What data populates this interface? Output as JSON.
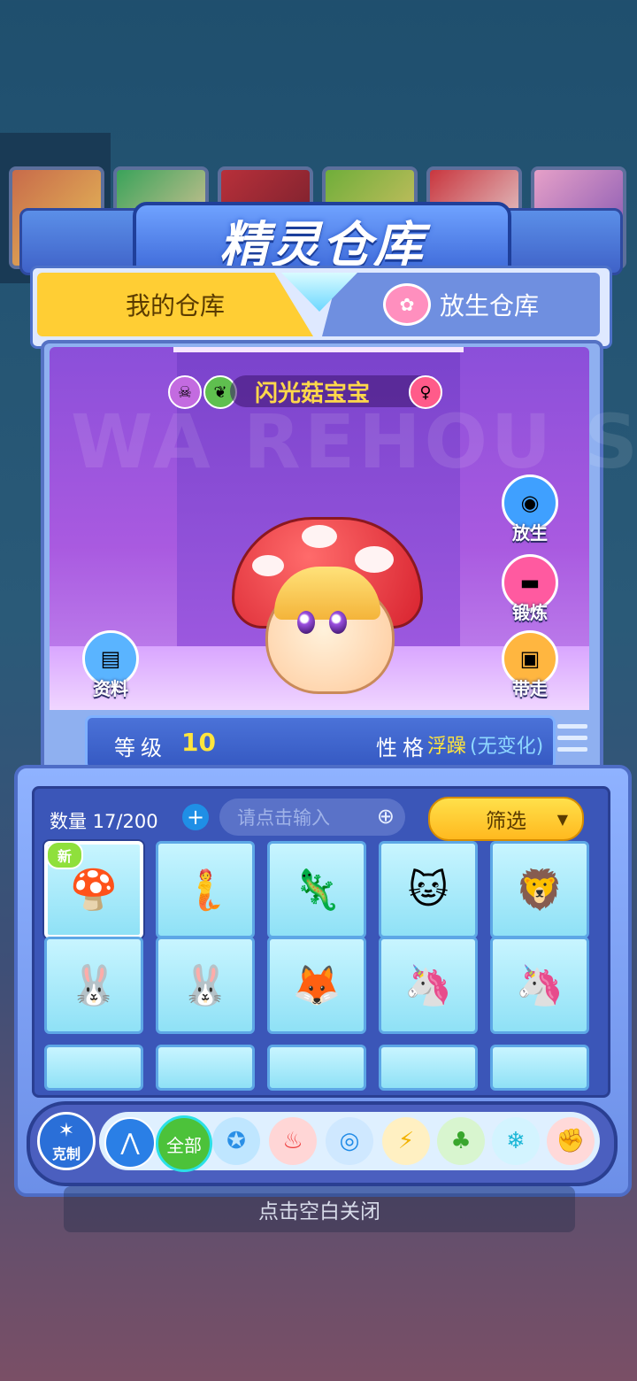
{
  "title": "精灵仓库",
  "tabs": {
    "mine": "我的仓库",
    "release": "放生仓库"
  },
  "display": {
    "watermark": "WA REHOU SE",
    "pet_name": "闪光菇宝宝",
    "badges": [
      "poison-type-icon",
      "grass-type-icon",
      "female-icon"
    ],
    "side_buttons": [
      {
        "label": "放生",
        "icon": "release-icon"
      },
      {
        "label": "锻炼",
        "icon": "dumbbell-icon"
      },
      {
        "label": "带走",
        "icon": "take-away-icon"
      },
      {
        "label": "资料",
        "icon": "profile-icon"
      }
    ]
  },
  "stats": {
    "level_label": "等级",
    "level_value": "10",
    "nature_label": "性格",
    "nature_value": "浮躁",
    "nature_note": "(无变化)"
  },
  "storage": {
    "count": "数量 17/200",
    "search_placeholder": "请点击输入",
    "filter_label": "筛选",
    "new_tag": "新"
  },
  "elements": {
    "restrain_label": "克制",
    "all_label": "全部",
    "items": [
      "collapse-icon",
      "all",
      "normal-icon",
      "fire-icon",
      "water-icon",
      "electric-icon",
      "grass-icon",
      "ice-icon",
      "fighting-icon"
    ]
  },
  "close_tip": "点击空白关闭",
  "colors": {
    "accent_yellow": "#ffce34",
    "panel_blue": "#4e6dc6",
    "room_purple": "#8b4fd9",
    "level_yellow": "#ffe53c"
  }
}
